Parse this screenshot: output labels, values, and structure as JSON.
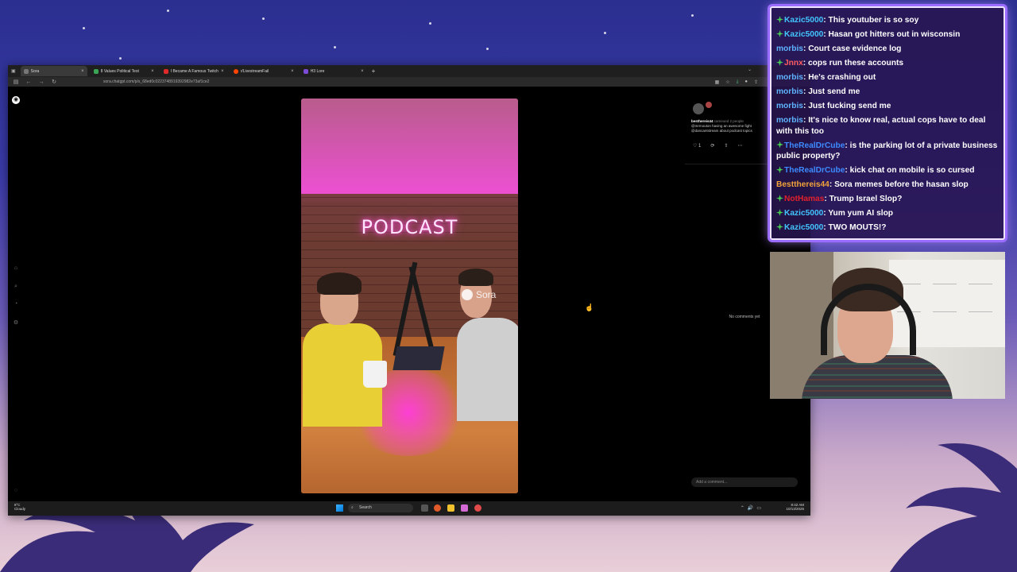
{
  "browser": {
    "tabs": [
      {
        "label": "Sora",
        "color": "#444444",
        "active": true
      },
      {
        "label": "8 Values Political Test",
        "color": "#3aa655"
      },
      {
        "label": "I Became A Famous Twitch Str...",
        "color": "#e02a2a"
      },
      {
        "label": "r/LivestreamFail",
        "color": "#ff4500"
      },
      {
        "label": "H3 Lore",
        "color": "#7b4bd6"
      }
    ],
    "url": "sora.chatgpt.com/p/s_68ed0c0223748919392982e73af1ce2"
  },
  "video": {
    "sign_text": "PODCAST",
    "watermark": "Sora"
  },
  "comments_panel": {
    "author": "besthereis44",
    "cameo_text": "cameoed 2 people",
    "desc_line1": "@mrmouton having an awesome fight",
    "desc_line2": "@dancantstream about podcast topics",
    "like_count": "1",
    "empty_text": "No comments yet",
    "add_placeholder": "Add a comment..."
  },
  "taskbar": {
    "weather_temp": "8°C",
    "weather_desc": "Cloudy",
    "search_label": "Search",
    "time": "8:42 AM",
    "date": "10/13/2025"
  },
  "chat": {
    "messages": [
      {
        "user": "Kazic5000",
        "color": "#43c6ff",
        "badge": true,
        "text": "This youtuber is so soy"
      },
      {
        "user": "Kazic5000",
        "color": "#43c6ff",
        "badge": true,
        "text": "Hasan got hitters out in wisconsin"
      },
      {
        "user": "morbis",
        "color": "#5fb4ff",
        "badge": false,
        "text": "Court case evidence log"
      },
      {
        "user": "Jnnx",
        "color": "#ff5c5c",
        "badge": true,
        "text": "cops run these accounts"
      },
      {
        "user": "morbis",
        "color": "#5fb4ff",
        "badge": false,
        "text": "He's crashing out"
      },
      {
        "user": "morbis",
        "color": "#5fb4ff",
        "badge": false,
        "text": "Just send me"
      },
      {
        "user": "morbis",
        "color": "#5fb4ff",
        "badge": false,
        "text": "Just fucking send me"
      },
      {
        "user": "morbis",
        "color": "#5fb4ff",
        "badge": false,
        "text": "It's nice to know real, actual cops have to deal with this too"
      },
      {
        "user": "TheRealDrCube",
        "color": "#3d8bff",
        "badge": true,
        "text": "is the parking lot of a private business public property?"
      },
      {
        "user": "TheRealDrCube",
        "color": "#3d8bff",
        "badge": true,
        "text": "kick chat on mobile is so cursed"
      },
      {
        "user": "Bestthereis44",
        "color": "#f2a43a",
        "badge": false,
        "text": "Sora memes before the hasan slop"
      },
      {
        "user": "NotHamas",
        "color": "#e0212b",
        "badge": true,
        "text": "Trump Israel Slop?"
      },
      {
        "user": "Kazic5000",
        "color": "#43c6ff",
        "badge": true,
        "text": "Yum yum AI slop"
      },
      {
        "user": "Kazic5000",
        "color": "#43c6ff",
        "badge": true,
        "text": "TWO MOUTS!?"
      }
    ]
  }
}
